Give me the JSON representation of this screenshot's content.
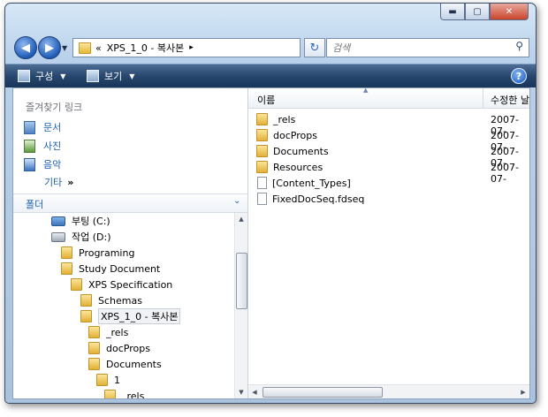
{
  "window": {
    "buttons": {
      "minimize": "▬",
      "maximize": "▢",
      "close": "✕"
    }
  },
  "nav": {
    "back_icon": "arrow-left-icon",
    "forward_icon": "arrow-right-icon",
    "address": {
      "prefix": "«",
      "path": "XPS_1_0 - 복사본",
      "dropdown": "▸"
    },
    "search_placeholder": "검색"
  },
  "toolbar": {
    "organize_label": "구성",
    "views_label": "보기"
  },
  "favorites": {
    "title": "즐겨찾기 링크",
    "items": [
      {
        "label": "문서",
        "icon": "documents-icon"
      },
      {
        "label": "사진",
        "icon": "pictures-icon"
      },
      {
        "label": "음악",
        "icon": "music-icon"
      }
    ],
    "more_label": "기타",
    "more_chevron": "»"
  },
  "folders_header": "폴더",
  "tree": [
    {
      "label": "부팅 (C:)",
      "type": "drive-system"
    },
    {
      "label": "작업 (D:)",
      "type": "drive"
    },
    {
      "label": "Programing",
      "type": "folder"
    },
    {
      "label": "Study Document",
      "type": "folder"
    },
    {
      "label": "XPS Specification",
      "type": "folder"
    },
    {
      "label": "Schemas",
      "type": "folder"
    },
    {
      "label": "XPS_1_0 - 복사본",
      "type": "folder",
      "selected": true
    },
    {
      "label": "_rels",
      "type": "folder"
    },
    {
      "label": "docProps",
      "type": "folder"
    },
    {
      "label": "Documents",
      "type": "folder"
    },
    {
      "label": "1",
      "type": "folder"
    },
    {
      "label": "_rels",
      "type": "folder"
    }
  ],
  "columns": {
    "name": "이름",
    "date": "수정한 날"
  },
  "files": [
    {
      "name": "_rels",
      "type": "folder",
      "date": "2007-07-"
    },
    {
      "name": "docProps",
      "type": "folder",
      "date": "2007-07-"
    },
    {
      "name": "Documents",
      "type": "folder",
      "date": "2007-07-"
    },
    {
      "name": "Resources",
      "type": "folder",
      "date": "2007-07-"
    },
    {
      "name": "[Content_Types]",
      "type": "file",
      "date": ""
    },
    {
      "name": "FixedDocSeq.fdseq",
      "type": "file",
      "date": ""
    }
  ],
  "colors": {
    "accent": "#1b5fb4",
    "toolbar": "#27476e"
  }
}
